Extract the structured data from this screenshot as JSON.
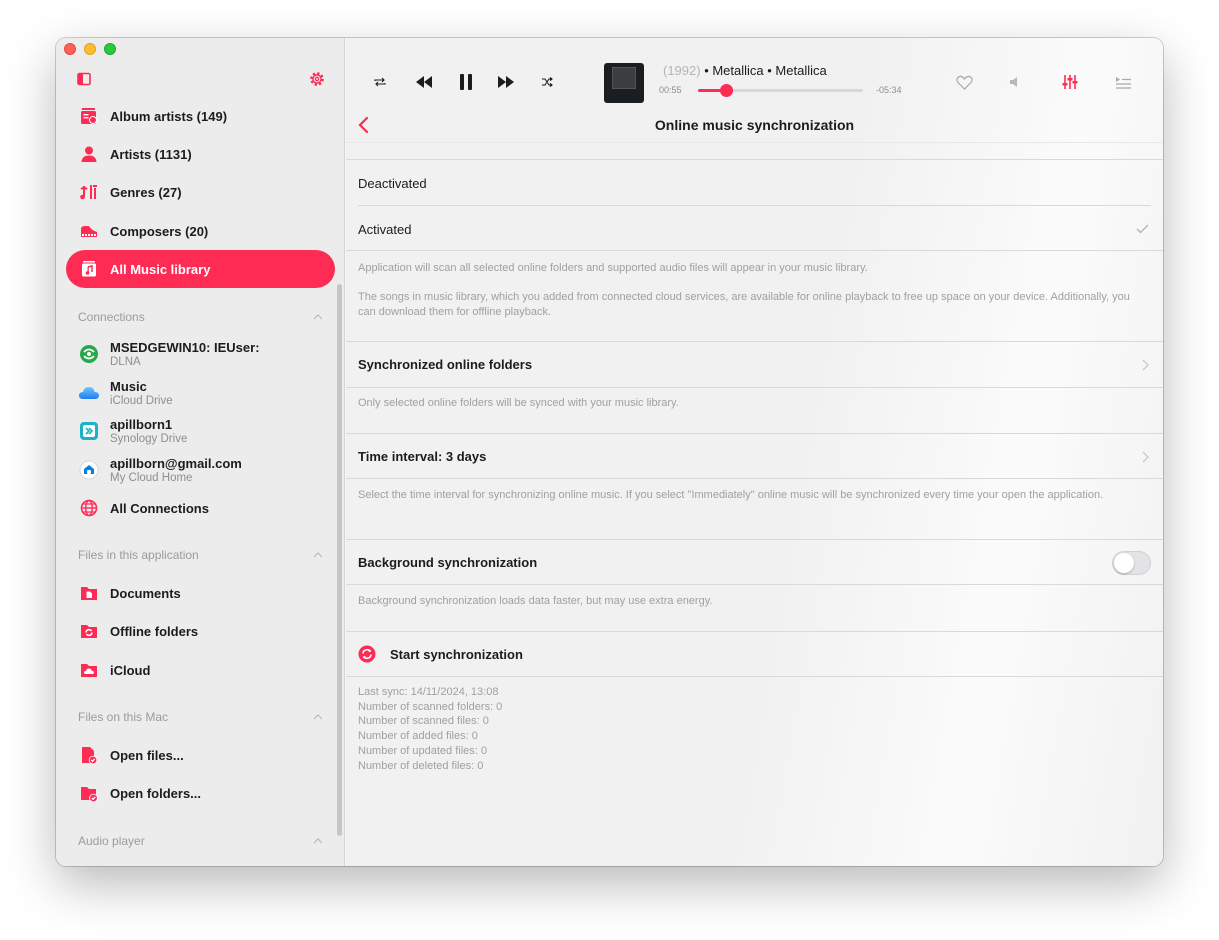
{
  "sidebar": {
    "library": [
      {
        "label": "Album artists (149)",
        "icon": "album-artists-icon"
      },
      {
        "label": "Artists (1131)",
        "icon": "artists-icon"
      },
      {
        "label": "Genres (27)",
        "icon": "genres-icon"
      },
      {
        "label": "Composers (20)",
        "icon": "composers-icon"
      },
      {
        "label": "All Music library",
        "icon": "music-library-icon",
        "active": true
      }
    ],
    "connections_header": "Connections",
    "connections": [
      {
        "title": "MSEDGEWIN10: IEUser:",
        "subtitle": "DLNA",
        "icon": "dlna-icon"
      },
      {
        "title": "Music",
        "subtitle": "iCloud Drive",
        "icon": "icloud-drive-icon"
      },
      {
        "title": "apillborn1",
        "subtitle": "Synology Drive",
        "icon": "synology-drive-icon"
      },
      {
        "title": "apillborn@gmail.com",
        "subtitle": "My Cloud Home",
        "icon": "my-cloud-home-icon"
      },
      {
        "title": "All Connections",
        "subtitle": "",
        "icon": "globe-icon"
      }
    ],
    "files_app_header": "Files in this application",
    "files_app": [
      {
        "label": "Documents",
        "icon": "documents-folder-icon"
      },
      {
        "label": "Offline folders",
        "icon": "offline-folder-icon"
      },
      {
        "label": "iCloud",
        "icon": "icloud-folder-icon"
      }
    ],
    "files_mac_header": "Files on this Mac",
    "files_mac": [
      {
        "label": "Open files...",
        "icon": "open-files-icon"
      },
      {
        "label": "Open folders...",
        "icon": "open-folders-icon"
      }
    ],
    "audio_player_header": "Audio player"
  },
  "player": {
    "track_fade": "(1992)",
    "track_main": " • Metallica • Metallica",
    "elapsed": "00:55",
    "remaining": "-05:34",
    "progress": 0.17
  },
  "page": {
    "title": "Online music synchronization",
    "deactivated": "Deactivated",
    "activated": "Activated",
    "activated_desc_1": "Application will scan all selected online folders and supported audio files will appear in your music library.",
    "activated_desc_2": "The songs in music library, which you added from connected cloud services, are available for online playback to free up space on your device. Additionally, you can download them for offline playback.",
    "sync_folders": "Synchronized online folders",
    "sync_folders_desc": "Only selected online folders will be synced with your music library.",
    "time_interval": "Time interval: 3 days",
    "time_interval_desc": "Select the time interval for synchronizing online music. If you select \"Immediately\" online music will be synchronized every time your open the application.",
    "background_sync": "Background synchronization",
    "background_sync_desc": "Background synchronization loads data faster, but may use extra energy.",
    "start_sync": "Start synchronization",
    "stats": {
      "last_sync": "Last sync: 14/11/2024, 13:08",
      "scanned_folders": "Number of scanned folders: 0",
      "scanned_files": "Number of scanned files: 0",
      "added_files": "Number of added files: 0",
      "updated_files": "Number of updated files: 0",
      "deleted_files": "Number of deleted files: 0"
    }
  },
  "colors": {
    "accent": "#fe2c55"
  }
}
